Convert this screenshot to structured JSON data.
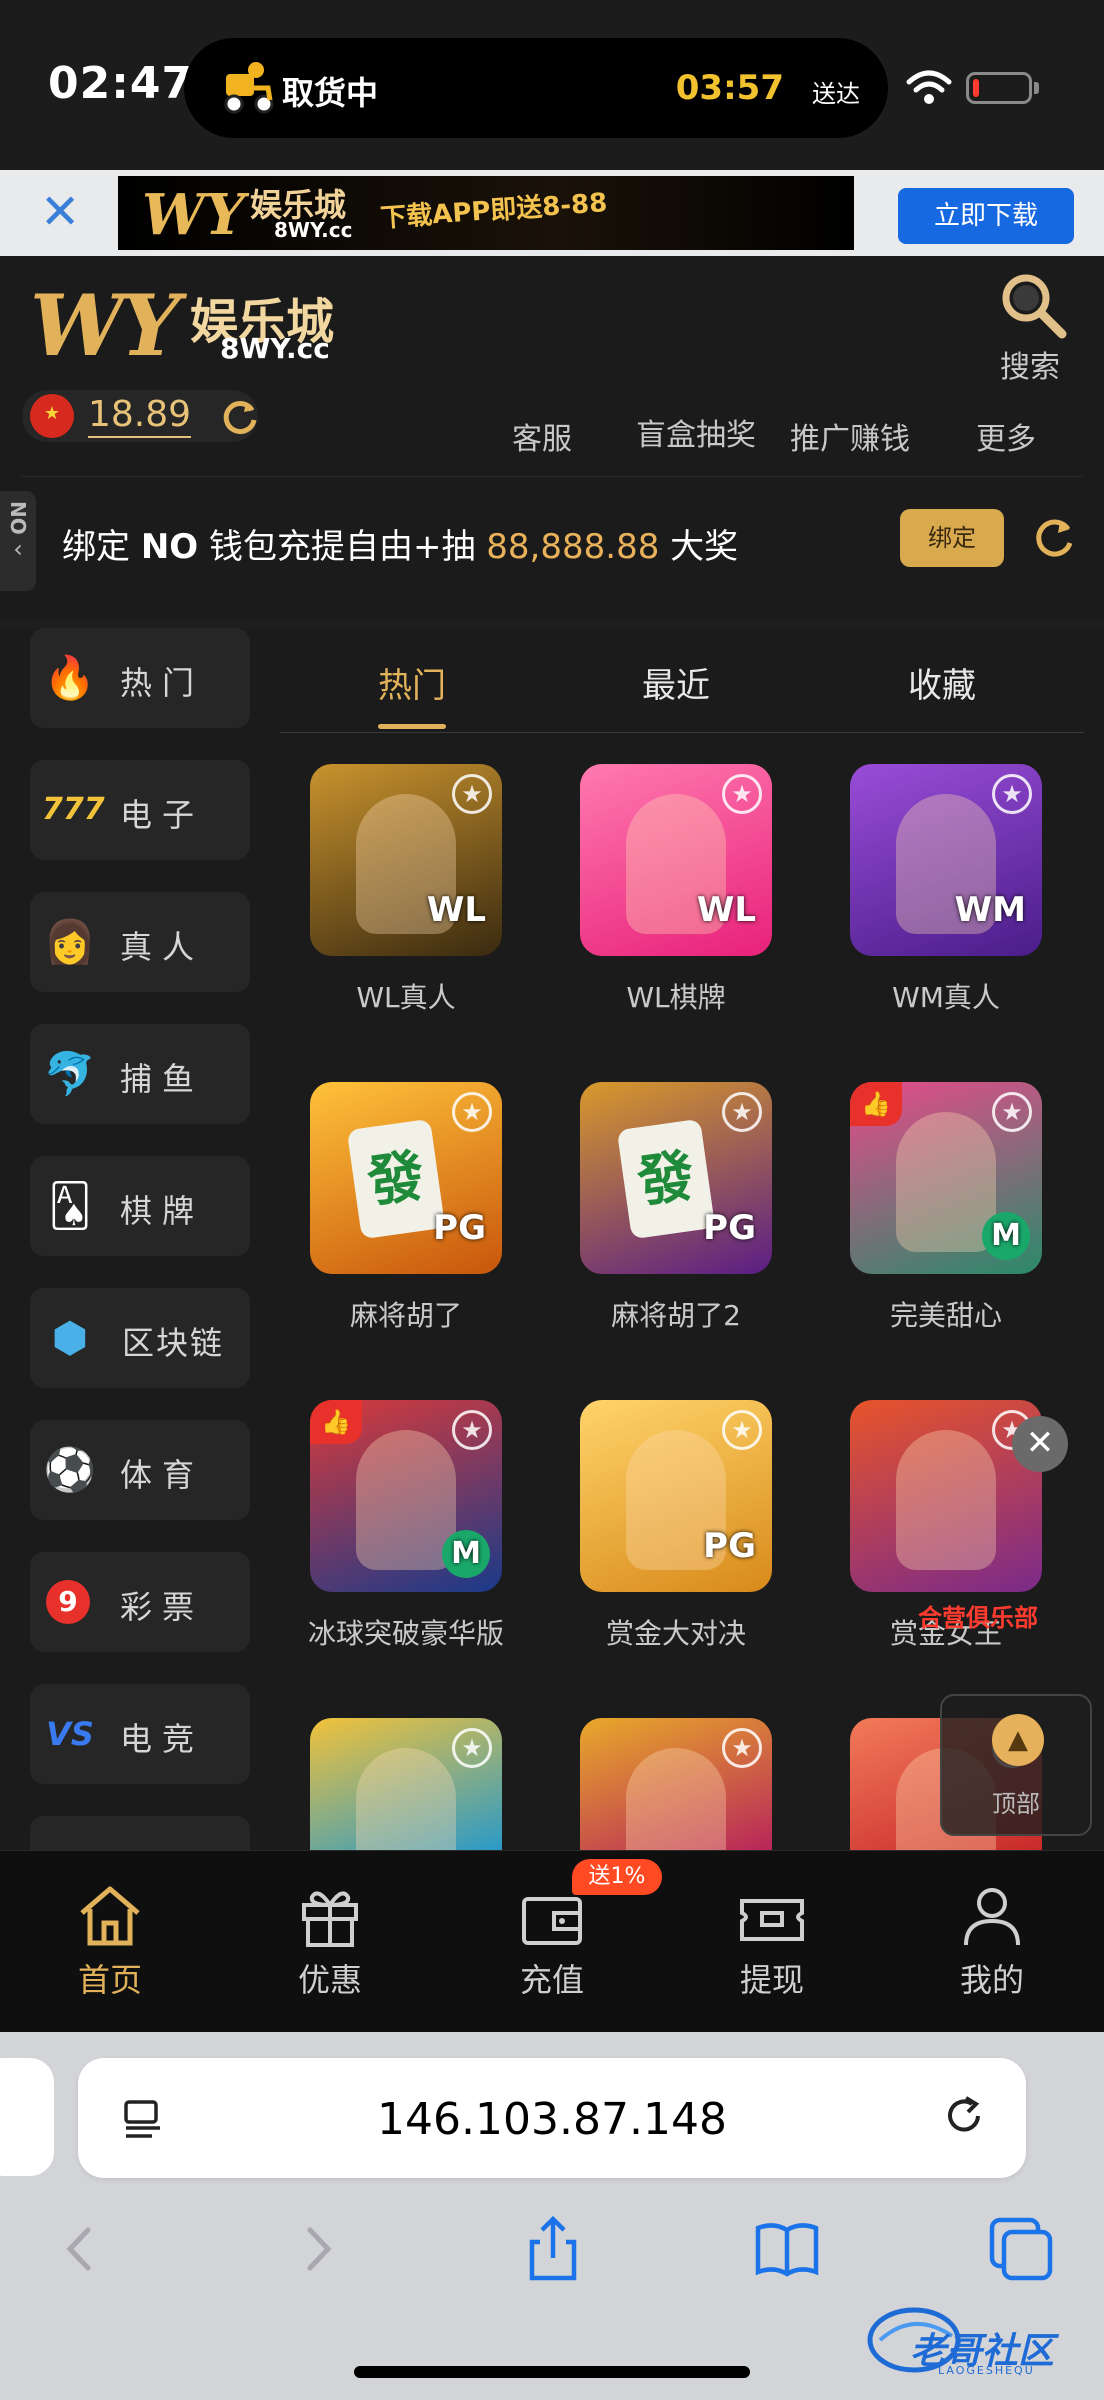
{
  "status_bar": {
    "time": "02:47",
    "activity_label": "取货中",
    "eta_time": "03:57",
    "eta_suffix": "送达",
    "battery_level": 0.1
  },
  "download_banner": {
    "close_symbol": "✕",
    "ad_logo": "WY",
    "ad_brand": "娱乐城",
    "ad_domain": "8WY.cc",
    "ad_promo": "下载APP即送8-88",
    "button_label": "立即下载"
  },
  "header": {
    "logo_mark": "WY",
    "logo_brand": "娱乐城",
    "logo_domain": "8WY.cc",
    "search_label": "搜索"
  },
  "account": {
    "balance": "18.89",
    "quick_links": [
      "客服",
      "盲盒抽奖",
      "推广赚钱",
      "更多"
    ]
  },
  "bind_notice": {
    "side_tab_label": "NO",
    "text_before": "绑定",
    "wallet_name": "NO",
    "text_middle": "钱包充提自由+抽",
    "amount": "88,888.88",
    "text_after": "大奖",
    "button_label": "绑定"
  },
  "categories": [
    {
      "label": "热门",
      "icon": "fire-icon",
      "glyph": "🔥"
    },
    {
      "label": "电子",
      "icon": "slot-777-icon",
      "glyph": "777"
    },
    {
      "label": "真人",
      "icon": "live-dealer-icon",
      "glyph": "👩"
    },
    {
      "label": "捕鱼",
      "icon": "fish-icon",
      "glyph": "🐬"
    },
    {
      "label": "棋牌",
      "icon": "cards-icon",
      "glyph": "🂡"
    },
    {
      "label": "区块链",
      "icon": "blockchain-icon",
      "glyph": "⬢"
    },
    {
      "label": "体育",
      "icon": "soccer-ball-icon",
      "glyph": "⚽"
    },
    {
      "label": "彩票",
      "icon": "lottery-balls-icon",
      "glyph": "9"
    },
    {
      "label": "电竞",
      "icon": "esports-vs-icon",
      "glyph": "VS"
    }
  ],
  "game_tabs": [
    "热门",
    "最近",
    "收藏"
  ],
  "active_game_tab": "热门",
  "games": [
    {
      "name": "WL真人",
      "provider": "WL",
      "hot": false,
      "colors": [
        "#3a2a10",
        "#c9932e"
      ]
    },
    {
      "name": "WL棋牌",
      "provider": "WL",
      "hot": false,
      "colors": [
        "#e8217a",
        "#ff7ab0"
      ]
    },
    {
      "name": "WM真人",
      "provider": "WM",
      "hot": false,
      "colors": [
        "#4a1d8a",
        "#9a4dd8"
      ]
    },
    {
      "name": "麻将胡了",
      "provider": "PG",
      "hot": false,
      "colors": [
        "#c8560c",
        "#ffc23a"
      ]
    },
    {
      "name": "麻将胡了2",
      "provider": "PG",
      "hot": false,
      "colors": [
        "#5a1d86",
        "#d89a2a"
      ]
    },
    {
      "name": "完美甜心",
      "provider": "M",
      "hot": true,
      "colors": [
        "#2a8a6a",
        "#e84a8a"
      ]
    },
    {
      "name": "冰球突破豪华版",
      "provider": "M",
      "hot": true,
      "colors": [
        "#1a3a8a",
        "#d83a3a"
      ]
    },
    {
      "name": "赏金大对决",
      "provider": "PG",
      "hot": false,
      "colors": [
        "#d88a1a",
        "#ffd46a"
      ]
    },
    {
      "name": "赏金女王",
      "provider": "",
      "hot": false,
      "colors": [
        "#7a2a8a",
        "#e8542a"
      ]
    },
    {
      "name": "",
      "provider": "",
      "hot": false,
      "colors": [
        "#2a9ac8",
        "#f2c23a"
      ]
    },
    {
      "name": "",
      "provider": "",
      "hot": false,
      "colors": [
        "#b8265a",
        "#e8a92a"
      ]
    },
    {
      "name": "",
      "provider": "",
      "hot": false,
      "colors": [
        "#c82a2a",
        "#f27a5a"
      ]
    }
  ],
  "overlay": {
    "close_symbol": "✕",
    "club_tag": "合营俱乐部",
    "back_to_top_label": "顶部"
  },
  "tabbar": {
    "items": [
      {
        "label": "首页",
        "icon": "home-icon",
        "active": true
      },
      {
        "label": "优惠",
        "icon": "gift-icon",
        "active": false
      },
      {
        "label": "充值",
        "icon": "wallet-icon",
        "active": false
      },
      {
        "label": "提现",
        "icon": "withdraw-ticket-icon",
        "active": false
      },
      {
        "label": "我的",
        "icon": "profile-icon",
        "active": false
      }
    ],
    "recharge_badge": "送1%"
  },
  "browser": {
    "url": "146.103.87.148"
  },
  "watermark": {
    "text": "老哥社区",
    "subtext": "LAOGESHEQU"
  },
  "colors": {
    "gold_accent": "#e1b25a",
    "background": "#1b1b1b",
    "download_button": "#1769e2",
    "badge_red": "#ff4a24"
  }
}
